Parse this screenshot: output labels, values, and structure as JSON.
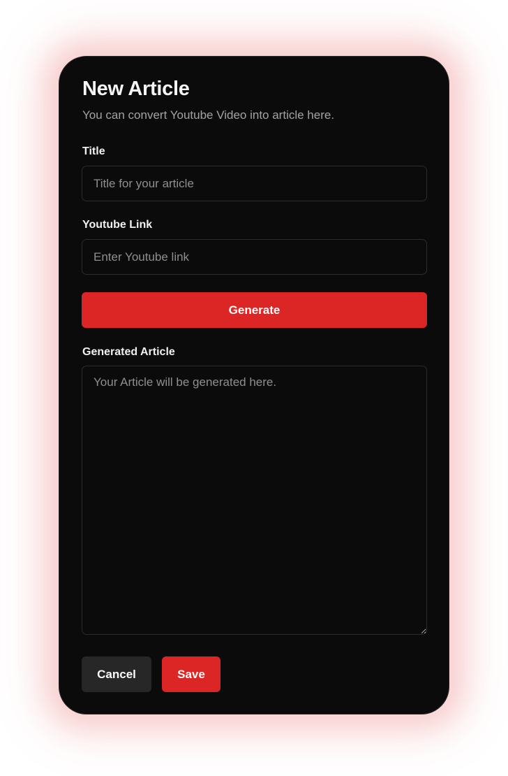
{
  "form": {
    "heading": "New Article",
    "description": "You can convert Youtube Video into article here.",
    "title_label": "Title",
    "title_placeholder": "Title for your article",
    "title_value": "",
    "link_label": "Youtube Link",
    "link_placeholder": "Enter Youtube link",
    "link_value": "",
    "generate_label": "Generate",
    "article_label": "Generated Article",
    "article_placeholder": "Your Article will be generated here.",
    "article_value": "",
    "cancel_label": "Cancel",
    "save_label": "Save"
  },
  "colors": {
    "accent": "#dc2626",
    "card_background": "#0b0b0b",
    "secondary_button": "#272727",
    "glow": "#e63c3c"
  }
}
